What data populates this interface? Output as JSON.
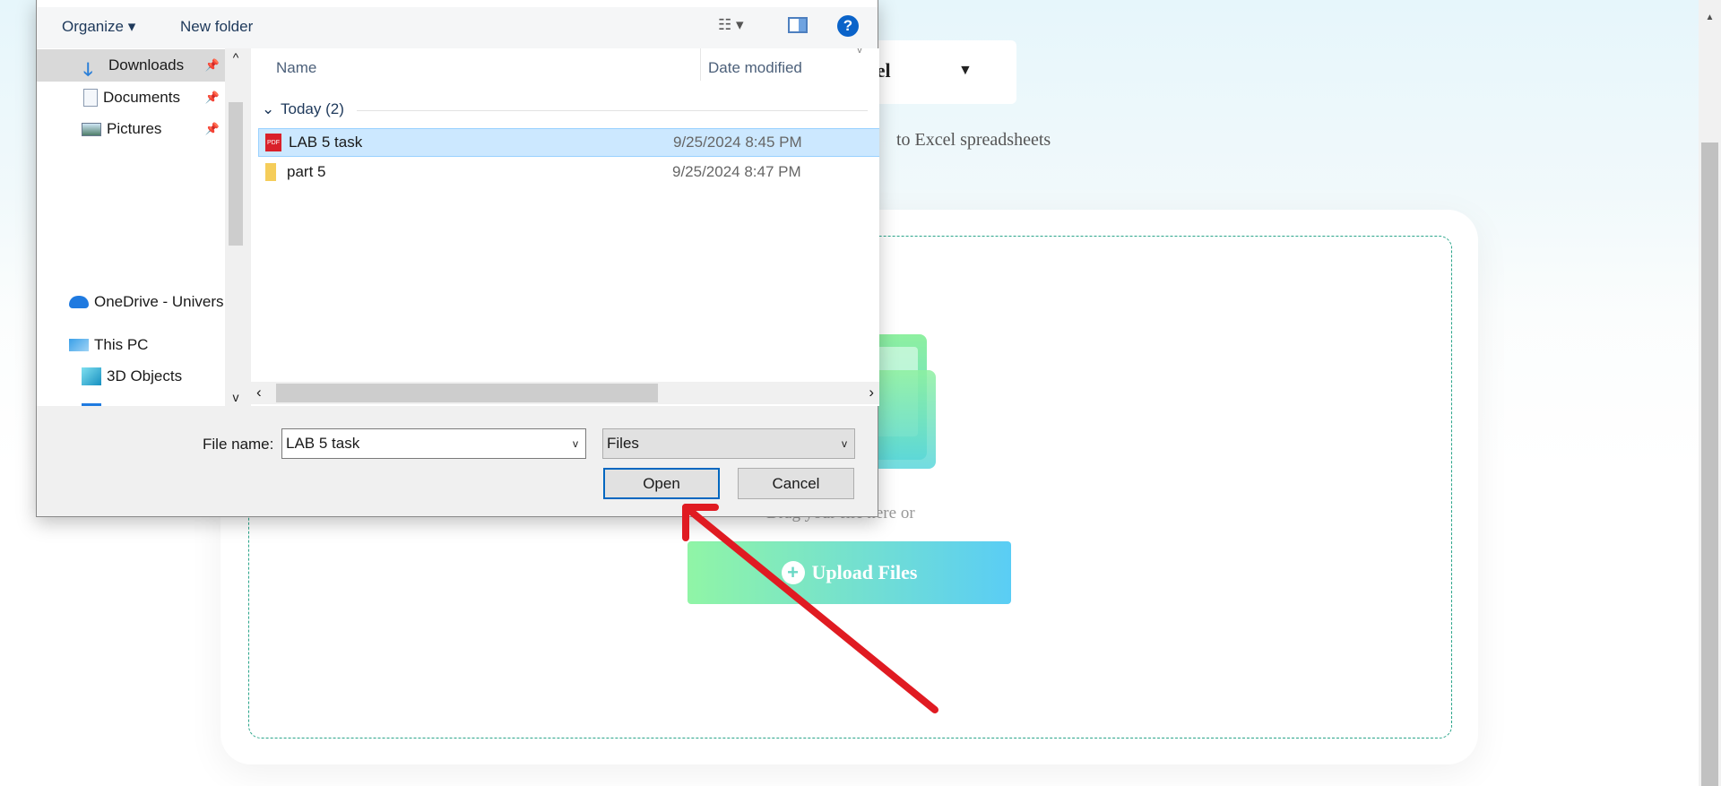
{
  "page": {
    "format_dropdown_text": "cel",
    "format_dropdown_arrow": "▼",
    "subtitle": "to Excel spreadsheets",
    "drag_text": "Drag your file here or",
    "upload_button": "Upload Files",
    "upload_icon": "plus-circle-icon",
    "upload_gradient": [
      "#90f5a6",
      "#5acdf5"
    ],
    "annotation_color": "#e01b22"
  },
  "dialog": {
    "toolbar": {
      "organize": "Organize ▾",
      "new_folder": "New folder",
      "help": "?"
    },
    "nav": {
      "items": [
        {
          "label": "Downloads",
          "icon": "download-arrow-icon",
          "pinned": true,
          "selected": true
        },
        {
          "label": "Documents",
          "icon": "document-icon",
          "pinned": true
        },
        {
          "label": "Pictures",
          "icon": "pictures-icon",
          "pinned": true
        },
        {
          "label": "OneDrive - Univers",
          "icon": "onedrive-cloud-icon"
        },
        {
          "label": "This PC",
          "icon": "computer-icon"
        },
        {
          "label": "3D Objects",
          "icon": "3d-cube-icon"
        }
      ]
    },
    "columns": {
      "name": "Name",
      "date": "Date modified"
    },
    "group": "Today (2)",
    "files": [
      {
        "name": "LAB 5 task",
        "date": "9/25/2024 8:45 PM",
        "icon": "pdf-icon",
        "selected": true
      },
      {
        "name": "part 5",
        "date": "9/25/2024 8:47 PM",
        "icon": "folder-icon"
      }
    ],
    "file_name_label": "File name:",
    "file_name_value": "LAB 5 task",
    "file_type": "Files",
    "open_button": "Open",
    "cancel_button": "Cancel"
  }
}
